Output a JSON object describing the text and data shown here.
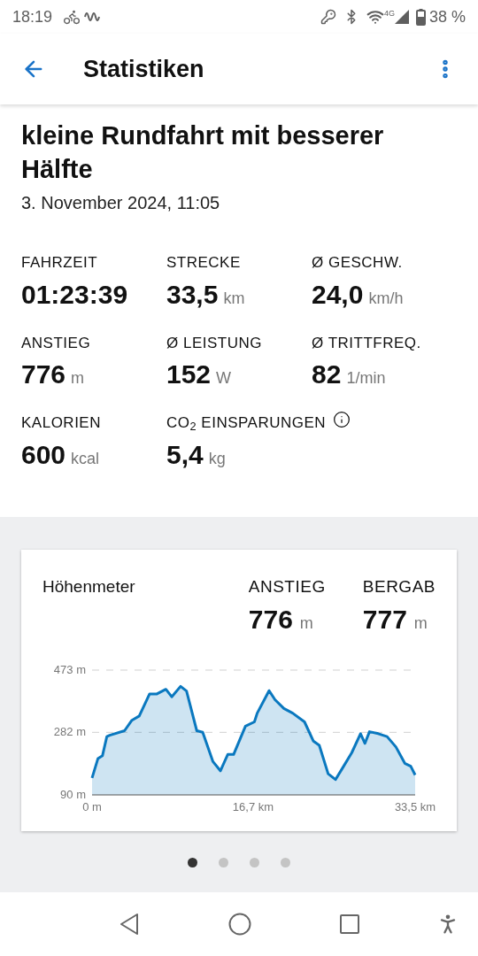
{
  "status_bar": {
    "time": "18:19",
    "network": "4G",
    "battery": "38 %"
  },
  "app_bar": {
    "title": "Statistiken"
  },
  "ride": {
    "title": "kleine Rundfahrt mit besserer Hälfte",
    "date": "3. November 2024, 11:05"
  },
  "stats": [
    {
      "label": "FAHRZEIT",
      "value": "01:23:39",
      "info": false
    },
    {
      "label": "STRECKE",
      "value": "33,5",
      "unit": "km",
      "info": false
    },
    {
      "label": "Ø GESCHW.",
      "value": "24,0",
      "unit": "km/h",
      "info": false
    },
    {
      "label": "ANSTIEG",
      "value": "776",
      "unit": "m",
      "info": false
    },
    {
      "label": "Ø LEISTUNG",
      "value": "152",
      "unit": "W",
      "info": false
    },
    {
      "label": "Ø TRITTFREQ.",
      "value": "82",
      "unit": "1/min",
      "info": false
    },
    {
      "label": "KALORIEN",
      "value": "600",
      "unit": "kcal",
      "info": false
    },
    {
      "label": "CO$_{2}$ EINSPARUNGEN",
      "value": "5,4",
      "unit": "kg",
      "info": true
    }
  ],
  "elevation_card": {
    "title": "Höhenmeter",
    "summary": [
      {
        "label": "ANSTIEG",
        "value": "776",
        "unit": "m"
      },
      {
        "label": "BERGAB",
        "value": "777",
        "unit": "m"
      }
    ],
    "chart_data": {
      "type": "area",
      "xlim": [
        0,
        33.5
      ],
      "ylim": [
        90,
        473
      ],
      "xticks": [
        {
          "value": 0,
          "label": "0 m"
        },
        {
          "value": 16.7,
          "label": "16,7 km"
        },
        {
          "value": 33.5,
          "label": "33,5 km"
        }
      ],
      "yticks": [
        {
          "value": 90,
          "label": "90 m"
        },
        {
          "value": 282,
          "label": "282 m"
        },
        {
          "value": 473,
          "label": "473 m"
        }
      ],
      "x": [
        0,
        0.61,
        1.07,
        1.53,
        1.84,
        3.37,
        4.13,
        4.89,
        5.97,
        6.73,
        7.65,
        8.26,
        9.18,
        9.79,
        10.86,
        11.47,
        12.54,
        13.31,
        14.07,
        14.68,
        15.91,
        16.83,
        17.13,
        18.36,
        18.97,
        19.89,
        20.8,
        22.03,
        22.95,
        23.56,
        24.48,
        25.24,
        26.0,
        26.92,
        27.84,
        28.3,
        28.76,
        29.67,
        30.59,
        31.51,
        32.43,
        33.04,
        33.5
      ],
      "series": [
        {
          "color": "#0a78bf",
          "values": [
            142,
            201,
            210,
            269,
            273,
            287,
            319,
            332,
            400,
            400,
            414,
            391,
            423,
            409,
            287,
            282,
            192,
            164,
            214,
            214,
            301,
            314,
            341,
            410,
            382,
            355,
            341,
            314,
            255,
            242,
            155,
            137,
            174,
            219,
            278,
            248,
            284,
            278,
            269,
            237,
            187,
            178,
            151
          ]
        }
      ]
    }
  },
  "pager": [
    {
      "selected": true
    },
    {
      "selected": false
    },
    {
      "selected": false
    },
    {
      "selected": false
    }
  ]
}
